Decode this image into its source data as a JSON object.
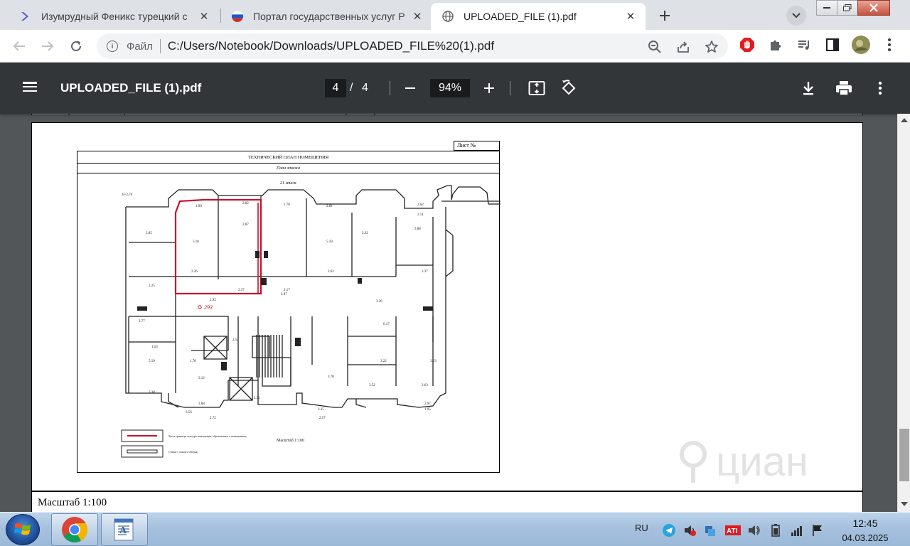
{
  "browser": {
    "tabs": [
      {
        "title": "Изумрудный Феникс турецкий с",
        "active": false,
        "favicon": "chevron-favicon"
      },
      {
        "title": "Портал государственных услуг Р",
        "active": false,
        "favicon": "russian-flag-favicon"
      },
      {
        "title": "UPLOADED_FILE (1).pdf",
        "active": true,
        "favicon": "globe-favicon"
      }
    ],
    "address": {
      "scheme_label": "Файл",
      "url": "C:/Users/Notebook/Downloads/UPLOADED_FILE%20(1).pdf"
    }
  },
  "pdf_viewer": {
    "title": "UPLOADED_FILE (1).pdf",
    "current_page": "4",
    "page_separator": "/",
    "total_pages": "4",
    "zoom": "94%"
  },
  "document": {
    "sheet_number_label": "Лист №",
    "plan_title": "ТЕХНИЧЕСКИЙ ПЛАН ПОМЕЩЕНИЯ",
    "plan_subtitle": "План этажа",
    "floor_label": "21 этаж",
    "height_label": "h=2,76",
    "room_number": "293",
    "inner_scale_label": "Масштаб 1:100",
    "legend": [
      "Часть границы контура помещения, образованного помещением",
      "Стена с окном и дверью"
    ],
    "scale_label": "Масштаб 1:100",
    "watermark": "циан"
  },
  "taskbar": {
    "language": "RU",
    "time": "12:45",
    "date": "04.03.2025"
  },
  "colors": {
    "pdf_toolbar": "#323639",
    "viewer_background": "#525659",
    "highlight_boundary": "#c8102e"
  }
}
